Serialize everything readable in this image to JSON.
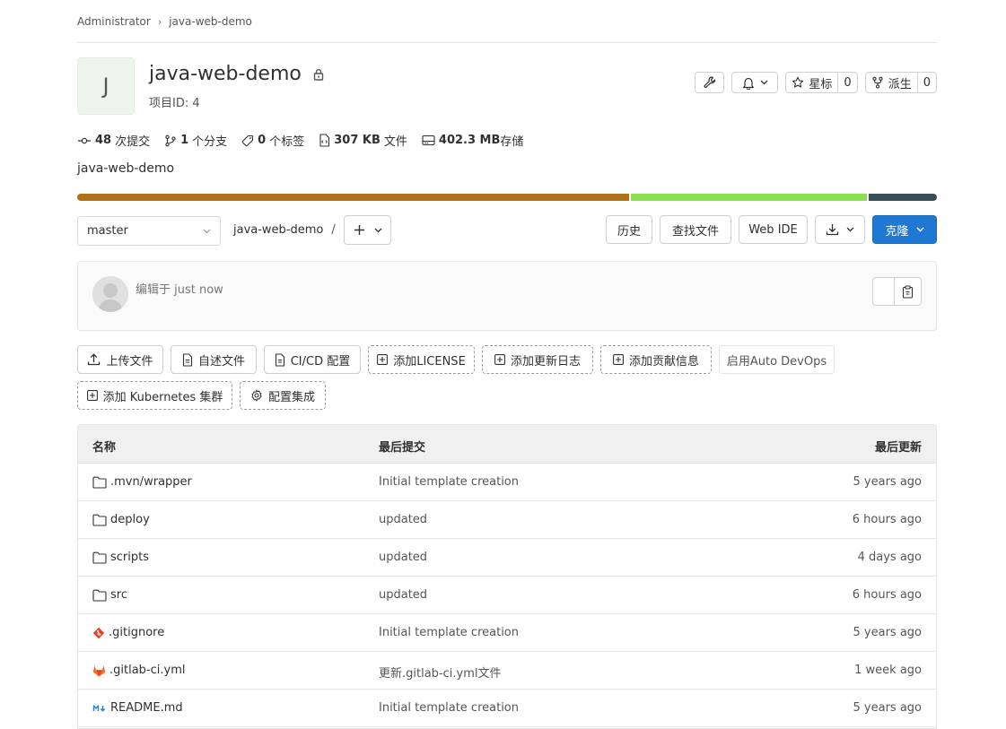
{
  "breadcrumb": {
    "owner": "Administrator",
    "project": "java-web-demo"
  },
  "project": {
    "avatar_letter": "J",
    "name": "java-web-demo",
    "id_label": "项目ID: 4",
    "description": "java-web-demo"
  },
  "header_actions": {
    "star_label": "星标",
    "star_count": "0",
    "fork_label": "派生",
    "fork_count": "0"
  },
  "stats": {
    "commits_value": "48",
    "commits_label": "次提交",
    "branches_value": "1",
    "branches_label": "个分支",
    "tags_value": "0",
    "tags_label": "个标签",
    "files_value": "307 KB",
    "files_label": "文件",
    "storage_value": "402.3 MB",
    "storage_label": "存储"
  },
  "languages": [
    {
      "color": "#b07219",
      "percent": 64.5
    },
    {
      "color": "#89e051",
      "percent": 27.5
    },
    {
      "color": "#384d54",
      "percent": 8.0
    }
  ],
  "tree": {
    "branch": "master",
    "path": "java-web-demo",
    "path_sep": "/",
    "history_label": "历史",
    "find_file_label": "查找文件",
    "web_ide_label": "Web IDE",
    "clone_label": "克隆"
  },
  "last_commit": {
    "text": "编辑于 just now"
  },
  "actions": {
    "upload": "上传文件",
    "readme": "自述文件",
    "cicd": "CI/CD 配置",
    "license": "添加LICENSE",
    "changelog": "添加更新日志",
    "contributing": "添加贡献信息",
    "auto_devops": "启用Auto DevOps",
    "kubernetes": "添加 Kubernetes 集群",
    "integrations": "配置集成"
  },
  "table": {
    "headers": {
      "name": "名称",
      "last_commit": "最后提交",
      "last_update": "最后更新"
    },
    "rows": [
      {
        "name": ".mvn/wrapper",
        "icon": "folder-icon",
        "commit": "Initial template creation",
        "time": "5 years ago"
      },
      {
        "name": "deploy",
        "icon": "folder-icon",
        "commit": "updated",
        "time": "6 hours ago"
      },
      {
        "name": "scripts",
        "icon": "folder-icon",
        "commit": "updated",
        "time": "4 days ago"
      },
      {
        "name": "src",
        "icon": "folder-icon",
        "commit": "updated",
        "time": "6 hours ago"
      },
      {
        "name": ".gitignore",
        "icon": "git-icon",
        "commit": "Initial template creation",
        "time": "5 years ago"
      },
      {
        "name": ".gitlab-ci.yml",
        "icon": "gitlab-icon",
        "commit": "更新.gitlab-ci.yml文件",
        "time": "1 week ago"
      },
      {
        "name": "README.md",
        "icon": "markdown-icon",
        "commit": "Initial template creation",
        "time": "5 years ago"
      }
    ]
  }
}
